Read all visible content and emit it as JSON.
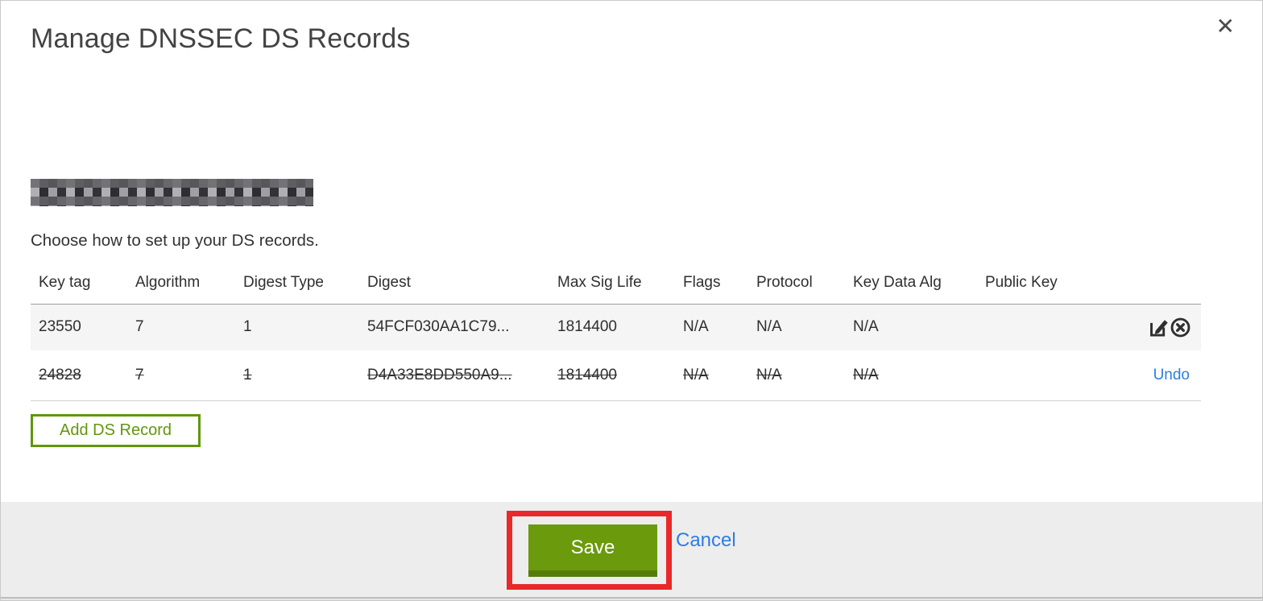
{
  "modal": {
    "title": "Manage DNSSEC DS Records",
    "close_glyph": "✕",
    "subtitle": "Choose how to set up your DS records.",
    "add_button_label": "Add DS Record",
    "save_label": "Save",
    "cancel_label": "Cancel"
  },
  "table": {
    "columns": [
      "Key tag",
      "Algorithm",
      "Digest Type",
      "Digest",
      "Max Sig Life",
      "Flags",
      "Protocol",
      "Key Data Alg",
      "Public Key"
    ],
    "rows": [
      {
        "key_tag": "23550",
        "algorithm": "7",
        "digest_type": "1",
        "digest": "54FCF030AA1C79...",
        "max_sig_life": "1814400",
        "flags": "N/A",
        "protocol": "N/A",
        "key_data_alg": "N/A",
        "public_key": "",
        "state": "normal",
        "actions": [
          "edit",
          "delete"
        ]
      },
      {
        "key_tag": "24828",
        "algorithm": "7",
        "digest_type": "1",
        "digest": "D4A33E8DD550A9...",
        "max_sig_life": "1814400",
        "flags": "N/A",
        "protocol": "N/A",
        "key_data_alg": "N/A",
        "public_key": "",
        "state": "deleted",
        "action_label": "Undo"
      }
    ]
  },
  "colors": {
    "accent_green": "#6B9A0C",
    "accent_green_dark": "#567C08",
    "outline_green": "#61970B",
    "link_blue": "#2F7DE1",
    "annotation_red": "#E9282A",
    "row_highlight_bg": "#F5F5F5",
    "footer_bg": "#EDEDED"
  }
}
